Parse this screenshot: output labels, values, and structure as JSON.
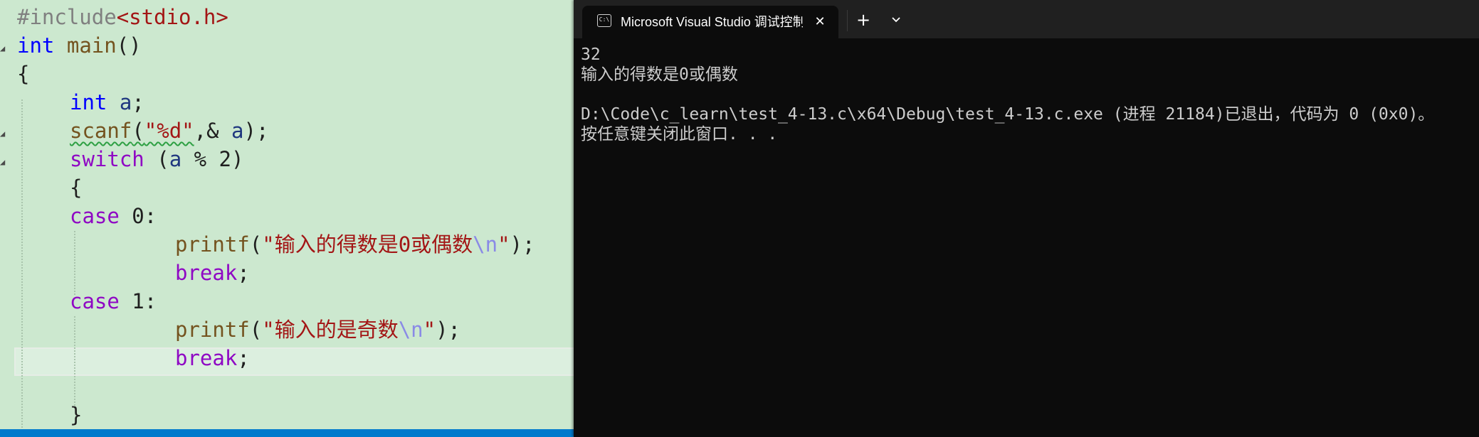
{
  "editor": {
    "lines": [
      {
        "tokens": [
          {
            "t": "#include",
            "c": "tk-pre"
          },
          {
            "t": "<stdio.h>",
            "c": "tk-str"
          }
        ]
      },
      {
        "tokens": [
          {
            "t": "int",
            "c": "tk-kw"
          },
          {
            "t": " ",
            "c": ""
          },
          {
            "t": "main",
            "c": "tk-fn"
          },
          {
            "t": "()",
            "c": ""
          }
        ]
      },
      {
        "tokens": [
          {
            "t": "{",
            "c": ""
          }
        ]
      },
      {
        "tokens": [
          {
            "t": "int",
            "c": "tk-kw"
          },
          {
            "t": " ",
            "c": ""
          },
          {
            "t": "a",
            "c": "tk-var"
          },
          {
            "t": ";",
            "c": ""
          }
        ]
      },
      {
        "tokens": [
          {
            "t": "scanf",
            "c": "tk-fn squiggle"
          },
          {
            "t": "(",
            "c": "squiggle"
          },
          {
            "t": "\"%d\"",
            "c": "tk-str squiggle"
          },
          {
            "t": ",& ",
            "c": ""
          },
          {
            "t": "a",
            "c": "tk-var"
          },
          {
            "t": ");",
            "c": ""
          }
        ]
      },
      {
        "tokens": [
          {
            "t": "switch",
            "c": "tk-ctl"
          },
          {
            "t": " (",
            "c": ""
          },
          {
            "t": "a",
            "c": "tk-var"
          },
          {
            "t": " % 2)",
            "c": ""
          }
        ]
      },
      {
        "tokens": [
          {
            "t": "{",
            "c": ""
          }
        ]
      },
      {
        "tokens": [
          {
            "t": "case",
            "c": "tk-ctl"
          },
          {
            "t": " 0:",
            "c": ""
          }
        ]
      },
      {
        "tokens": [
          {
            "t": "printf",
            "c": "tk-fn"
          },
          {
            "t": "(",
            "c": ""
          },
          {
            "t": "\"输入的得数是0或偶数",
            "c": "tk-str"
          },
          {
            "t": "\\n",
            "c": "tk-esc"
          },
          {
            "t": "\"",
            "c": "tk-str"
          },
          {
            "t": ");",
            "c": ""
          }
        ]
      },
      {
        "tokens": [
          {
            "t": "break",
            "c": "tk-ctl"
          },
          {
            "t": ";",
            "c": ""
          }
        ]
      },
      {
        "tokens": [
          {
            "t": "case",
            "c": "tk-ctl"
          },
          {
            "t": " 1:",
            "c": ""
          }
        ]
      },
      {
        "tokens": [
          {
            "t": "printf",
            "c": "tk-fn"
          },
          {
            "t": "(",
            "c": ""
          },
          {
            "t": "\"输入的是奇数",
            "c": "tk-str"
          },
          {
            "t": "\\n",
            "c": "tk-esc"
          },
          {
            "t": "\"",
            "c": "tk-str"
          },
          {
            "t": ");",
            "c": ""
          }
        ]
      },
      {
        "tokens": [
          {
            "t": "break",
            "c": "tk-ctl"
          },
          {
            "t": ";",
            "c": ""
          }
        ]
      },
      {
        "tokens": []
      },
      {
        "tokens": [
          {
            "t": "}",
            "c": ""
          }
        ]
      }
    ]
  },
  "terminal": {
    "tab_title": "Microsoft Visual Studio 调试控制台",
    "tab_icon_glyph": "C:\\",
    "close_glyph": "✕",
    "new_tab_glyph": "+",
    "output_lines": [
      "32",
      "输入的得数是0或偶数",
      "",
      "D:\\Code\\c_learn\\test_4-13.c\\x64\\Debug\\test_4-13.c.exe (进程 21184)已退出，代码为 0 (0x0)。",
      "按任意键关闭此窗口. . ."
    ]
  },
  "colors": {
    "editor_bg": "#cce8cf",
    "terminal_bg": "#0c0c0c",
    "titlebar_bg": "#202020",
    "status_bar": "#007acc"
  }
}
